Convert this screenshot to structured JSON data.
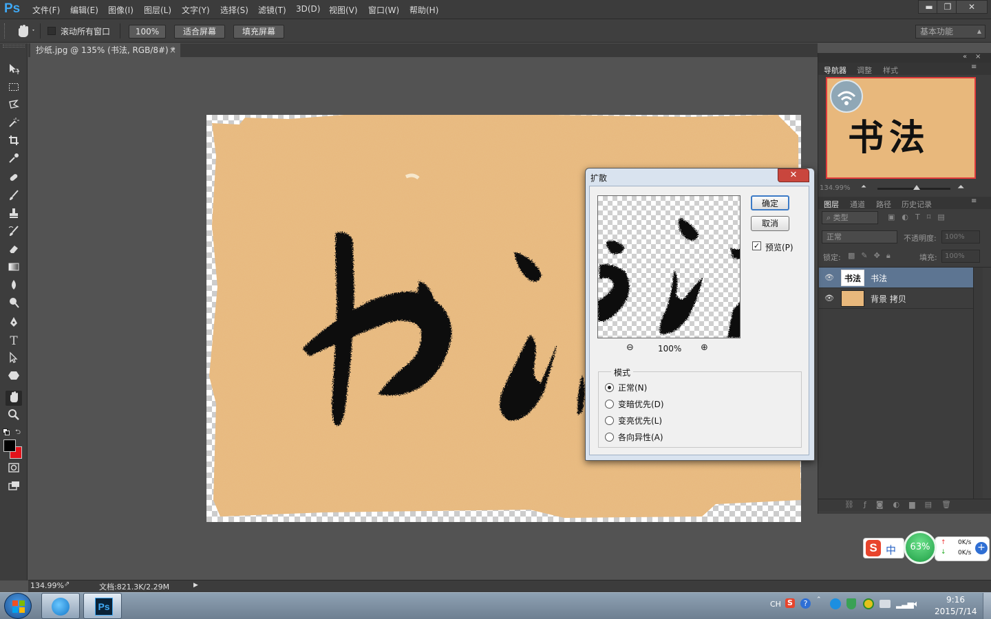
{
  "app": {
    "logo": "Ps"
  },
  "menu": [
    "文件(F)",
    "编辑(E)",
    "图像(I)",
    "图层(L)",
    "文字(Y)",
    "选择(S)",
    "滤镜(T)",
    "3D(D)",
    "视图(V)",
    "窗口(W)",
    "帮助(H)"
  ],
  "window_controls": {
    "minimize": "▬",
    "restore": "❐",
    "close": "✕"
  },
  "options": {
    "scroll_all_label": "滚动所有窗口",
    "zoom_100": "100%",
    "fit_screen": "适合屏幕",
    "fill_screen": "填充屏幕",
    "workspace": "基本功能"
  },
  "document": {
    "tab_title": "抄纸.jpg @ 135% (书法, RGB/8#) *",
    "tab_close": "×",
    "artwork_text": "书法"
  },
  "status": {
    "zoom": "134.99%",
    "doc_info": "文档:821.3K/2.29M"
  },
  "navigator": {
    "tabs": [
      "导航器",
      "调整",
      "样式"
    ],
    "thumb_text": "书法",
    "zoom": "134.99%"
  },
  "layers_panel": {
    "tabs": [
      "图层",
      "通道",
      "路径",
      "历史记录"
    ],
    "filter_label": "类型",
    "blend_mode": "正常",
    "opacity_label": "不透明度:",
    "opacity_value": "100%",
    "lock_label": "锁定:",
    "fill_label": "填充:",
    "fill_value": "100%",
    "layers": [
      {
        "name": "书法",
        "selected": true
      },
      {
        "name": "背景 拷贝",
        "selected": false
      }
    ]
  },
  "dialog": {
    "title": "扩散",
    "close": "✕",
    "ok": "确定",
    "cancel": "取消",
    "preview_label": "预览(P)",
    "preview_checked": true,
    "preview_zoom": "100%",
    "mode_group_label": "模式",
    "modes": [
      {
        "label": "正常(N)",
        "selected": true
      },
      {
        "label": "变暗优先(D)",
        "selected": false
      },
      {
        "label": "变亮优先(L)",
        "selected": false
      },
      {
        "label": "各向异性(A)",
        "selected": false
      }
    ]
  },
  "ime_widget": {
    "lang": "中",
    "percent": "63%",
    "speed_up": "0K/s",
    "speed_down": "0K/s"
  },
  "taskbar": {
    "lang": "CH",
    "time": "9:16",
    "date": "2015/7/14"
  },
  "colors": {
    "ps_blue": "#3fa9f5",
    "paper": "#e8b87c",
    "ink": "#111111",
    "layer_selected": "#5d7592",
    "dialog_close": "#c9463d"
  }
}
